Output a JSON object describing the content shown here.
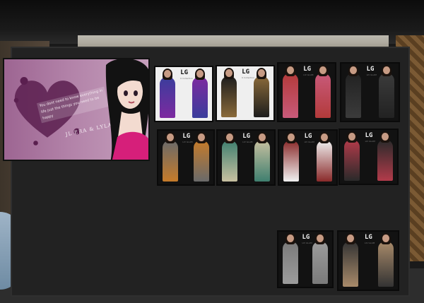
{
  "scene": {
    "colors": {
      "board": "#222222",
      "banner": "#b282a8",
      "frame": "#0a0a0a"
    }
  },
  "banner": {
    "quote": "You dont need to know everything in life just the things you need to be happy",
    "signature": "JL ERA & LYLAH",
    "icons": [
      "heart-icon",
      "girl-portrait"
    ]
  },
  "vendors": [
    {
      "logo": "LG",
      "sub": "K Collection",
      "style": "light",
      "colors": [
        "#3a3d9c",
        "#7d2aa0"
      ]
    },
    {
      "logo": "LG",
      "sub": "K Collection",
      "style": "light",
      "colors": [
        "#1d1d1d",
        "#8a6a3a"
      ]
    },
    {
      "logo": "LG",
      "sub": "LIV GLAM",
      "style": "dark",
      "colors": [
        "#b33a3a",
        "#c85a7a"
      ]
    },
    {
      "logo": "LG",
      "sub": "LIV GLAM",
      "style": "dark",
      "colors": [
        "#222222",
        "#3b3b3b"
      ]
    },
    {
      "logo": "LG",
      "sub": "LIV GLAM",
      "style": "dark",
      "colors": [
        "#6a6a6a",
        "#c57b2a"
      ]
    },
    {
      "logo": "LG",
      "sub": "LIV GLAM",
      "style": "dark",
      "colors": [
        "#3f7f6f",
        "#c7c0a0"
      ]
    },
    {
      "logo": "LG",
      "sub": "LIV GLAM",
      "style": "dark",
      "colors": [
        "#8a2a2a",
        "#f0f0f0"
      ]
    },
    {
      "logo": "LG",
      "sub": "LIV GLAM",
      "style": "dark",
      "colors": [
        "#b23b4a",
        "#2a2a2a"
      ]
    },
    {
      "logo": "LG",
      "sub": "LIV GLAM",
      "style": "dark",
      "colors": [
        "#7a7a7a",
        "#9c9c9c"
      ]
    },
    {
      "logo": "LG",
      "sub": "LIV GLAM",
      "style": "dark",
      "colors": [
        "#333333",
        "#a88a6a"
      ]
    }
  ]
}
